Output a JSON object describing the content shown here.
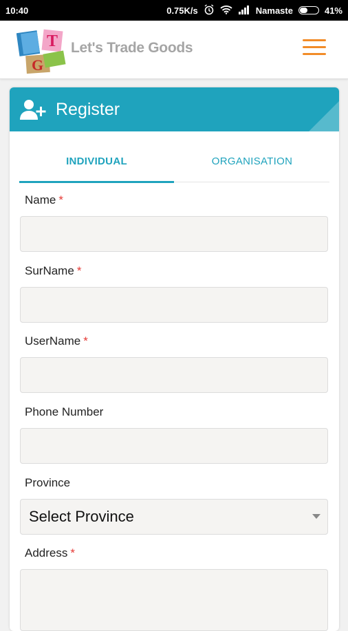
{
  "status": {
    "time": "10:40",
    "speed": "0.75K/s",
    "carrier": "Namaste",
    "battery": "41%"
  },
  "app": {
    "brand": "Let's Trade Goods",
    "logo_letters": [
      "T",
      "G"
    ]
  },
  "card": {
    "title": "Register"
  },
  "tabs": [
    {
      "label": "INDIVIDUAL",
      "active": true
    },
    {
      "label": "ORGANISATION",
      "active": false
    }
  ],
  "form": {
    "name_label": "Name",
    "surname_label": "SurName",
    "username_label": "UserName",
    "phone_label": "Phone Number",
    "province_label": "Province",
    "province_value": "Select Province",
    "address_label": "Address",
    "required_mark": "*"
  },
  "colors": {
    "accent": "#1fa3bd",
    "menu": "#f28c28",
    "required": "#e53935"
  },
  "icons": [
    "alarm-icon",
    "wifi-icon",
    "signal-icon",
    "battery-icon",
    "menu-icon",
    "add-user-icon",
    "dropdown-caret-icon"
  ]
}
